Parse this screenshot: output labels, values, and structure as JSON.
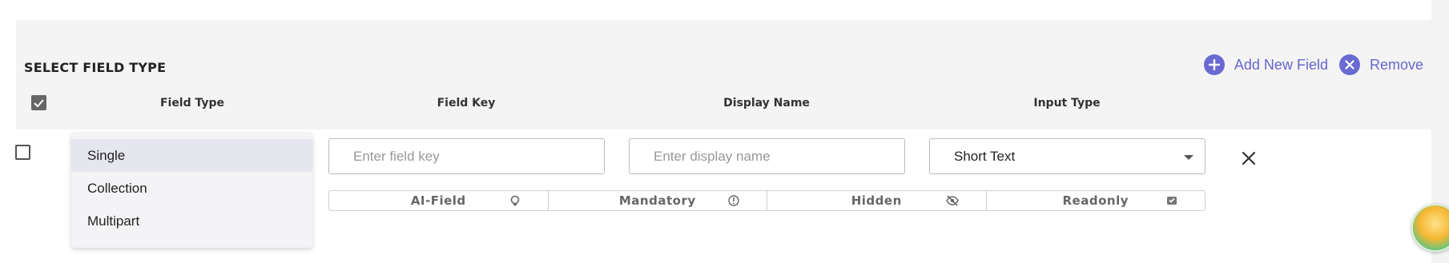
{
  "section": {
    "title": "SELECT FIELD TYPE"
  },
  "actions": {
    "add_label": "Add New Field",
    "remove_label": "Remove"
  },
  "columns": {
    "field_type": "Field Type",
    "field_key": "Field Key",
    "display_name": "Display Name",
    "input_type": "Input Type"
  },
  "row": {
    "field_key_placeholder": "Enter field key",
    "display_name_placeholder": "Enter display name",
    "input_type_value": "Short Text",
    "field_type_options": [
      "Single",
      "Collection",
      "Multipart"
    ],
    "field_type_selected": "Single"
  },
  "toggles": [
    {
      "label": "AI-Field",
      "icon": "lightbulb-icon"
    },
    {
      "label": "Mandatory",
      "icon": "info-icon"
    },
    {
      "label": "Hidden",
      "icon": "eye-off-icon"
    },
    {
      "label": "Readonly",
      "icon": "readonly-icon"
    }
  ],
  "colors": {
    "accent": "#6a6ad2",
    "header_bg": "#f4f4f4"
  }
}
